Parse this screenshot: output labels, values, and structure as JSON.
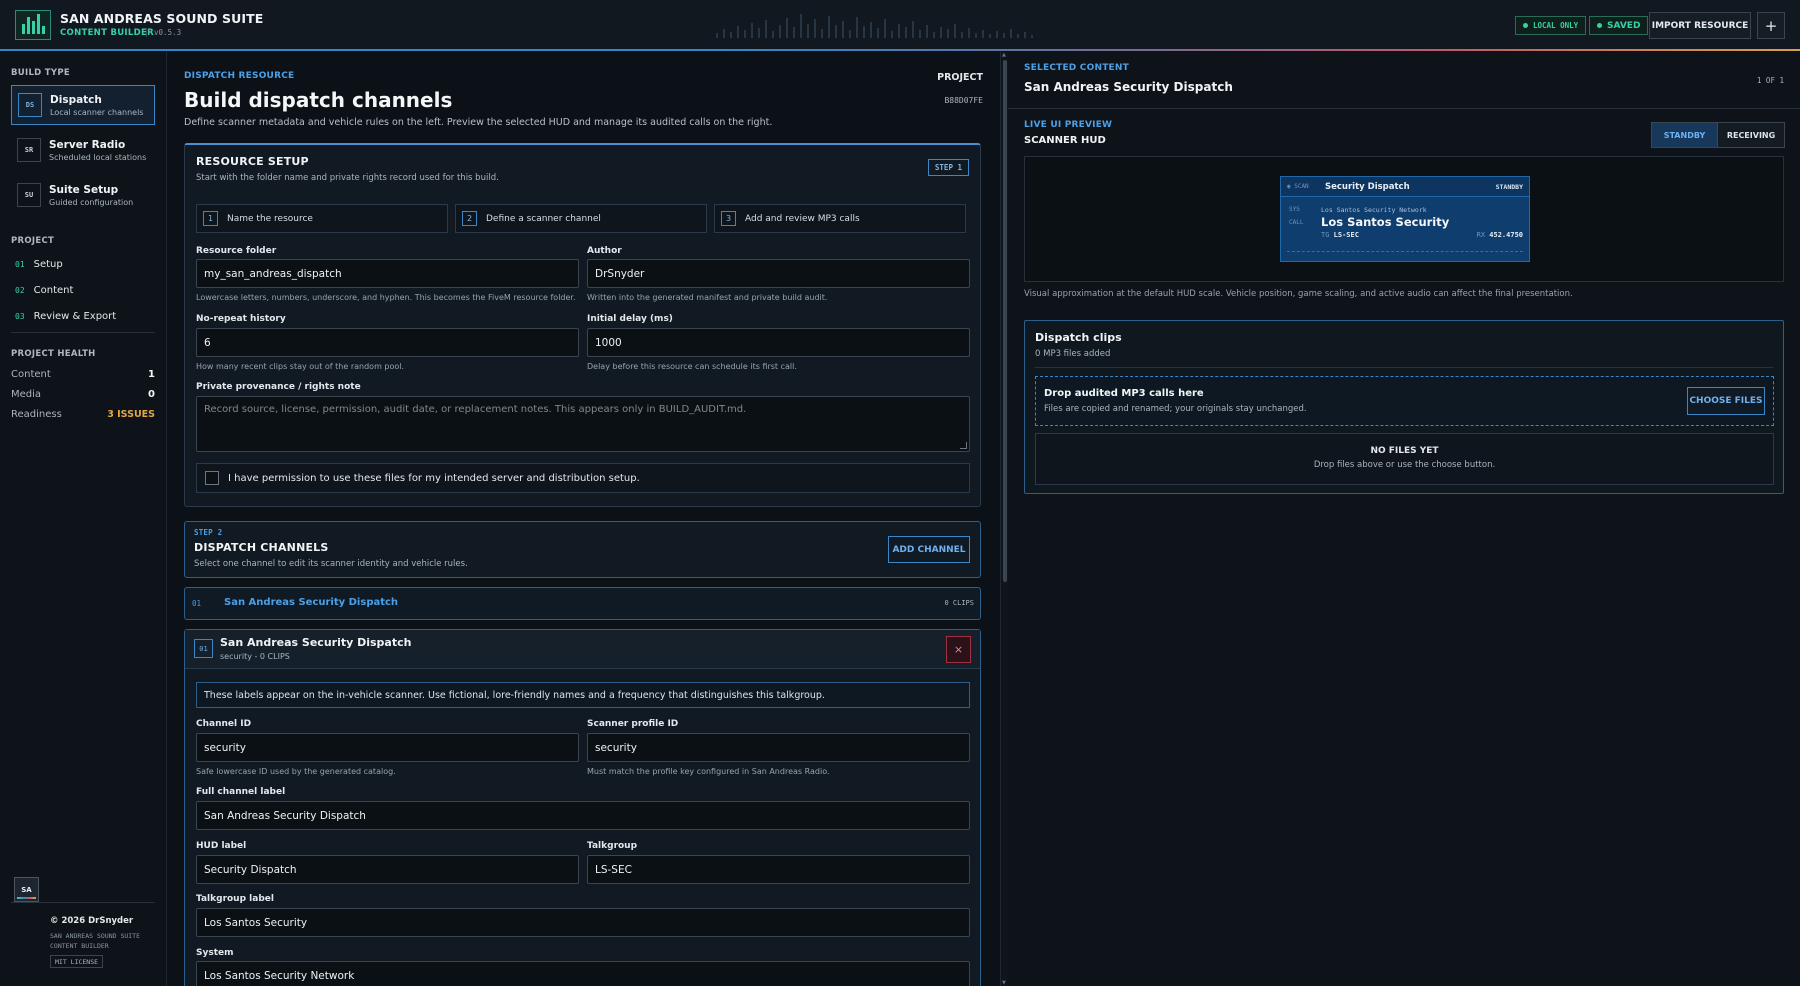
{
  "app": {
    "title": "SAN ANDREAS SOUND SUITE",
    "subtitle": "CONTENT BUILDER",
    "version": "v0.5.3"
  },
  "header": {
    "status_local": "LOCAL ONLY",
    "status_saved": "SAVED",
    "import_label": "IMPORT RESOURCE",
    "add_label": "+"
  },
  "sidebar": {
    "build_type_heading": "BUILD TYPE",
    "build_types": [
      {
        "icon": "DS",
        "name": "Dispatch",
        "desc": "Local scanner channels",
        "active": true
      },
      {
        "icon": "SR",
        "name": "Server Radio",
        "desc": "Scheduled local stations",
        "active": false
      },
      {
        "icon": "SU",
        "name": "Suite Setup",
        "desc": "Guided configuration",
        "active": false
      }
    ],
    "project_heading": "PROJECT",
    "project_items": [
      {
        "num": "01",
        "label": "Setup"
      },
      {
        "num": "02",
        "label": "Content"
      },
      {
        "num": "03",
        "label": "Review & Export"
      }
    ],
    "health_heading": "PROJECT HEALTH",
    "health": [
      {
        "label": "Content",
        "value": "1"
      },
      {
        "label": "Media",
        "value": "0"
      },
      {
        "label": "Readiness",
        "value": "3 ISSUES"
      }
    ],
    "footer": {
      "logo": "SA",
      "copyright": "© 2026 DrSnyder",
      "line1": "SAN ANDREAS SOUND SUITE",
      "line2": "CONTENT BUILDER",
      "license": "MIT LICENSE"
    }
  },
  "main": {
    "kicker": "DISPATCH RESOURCE",
    "title": "Build dispatch channels",
    "description": "Define scanner metadata and vehicle rules on the left. Preview the selected HUD and manage its audited calls on the right.",
    "project_label": "PROJECT",
    "project_id": "B88D07FE",
    "setup": {
      "heading": "RESOURCE SETUP",
      "sub": "Start with the folder name and private rights record used for this build.",
      "step_badge": "STEP 1",
      "steps": [
        {
          "num": "1",
          "label": "Name the resource"
        },
        {
          "num": "2",
          "label": "Define a scanner channel"
        },
        {
          "num": "3",
          "label": "Add and review MP3 calls"
        }
      ],
      "folder_label": "Resource folder",
      "folder_value": "my_san_andreas_dispatch",
      "folder_hint": "Lowercase letters, numbers, underscore, and hyphen. This becomes the FiveM resource folder.",
      "author_label": "Author",
      "author_value": "DrSnyder",
      "author_hint": "Written into the generated manifest and private build audit.",
      "norepeat_label": "No-repeat history",
      "norepeat_value": "6",
      "norepeat_hint": "How many recent clips stay out of the random pool.",
      "delay_label": "Initial delay (ms)",
      "delay_value": "1000",
      "delay_hint": "Delay before this resource can schedule its first call.",
      "rights_label": "Private provenance / rights note",
      "rights_placeholder": "Record source, license, permission, audit date, or replacement notes. This appears only in BUILD_AUDIT.md.",
      "permission_label": "I have permission to use these files for my intended server and distribution setup."
    },
    "channels": {
      "step_kicker": "STEP 2",
      "heading": "DISPATCH CHANNELS",
      "sub": "Select one channel to edit its scanner identity and vehicle rules.",
      "add_label": "ADD CHANNEL",
      "list": [
        {
          "num": "01",
          "name": "San Andreas Security Dispatch",
          "clips": "0 CLIPS"
        }
      ]
    },
    "editor": {
      "num": "01",
      "name": "San Andreas Security Dispatch",
      "meta": "security - 0 CLIPS",
      "delete_label": "×",
      "info": "These labels appear on the in-vehicle scanner. Use fictional, lore-friendly names and a frequency that distinguishes this talkgroup.",
      "channel_id_label": "Channel ID",
      "channel_id_value": "security",
      "channel_id_hint": "Safe lowercase ID used by the generated catalog.",
      "profile_label": "Scanner profile ID",
      "profile_value": "security",
      "profile_hint": "Must match the profile key configured in San Andreas Radio.",
      "full_label_label": "Full channel label",
      "full_label_value": "San Andreas Security Dispatch",
      "hud_label_label": "HUD label",
      "hud_label_value": "Security Dispatch",
      "talkgroup_label": "Talkgroup",
      "talkgroup_value": "LS-SEC",
      "tg_label_label": "Talkgroup label",
      "tg_label_value": "Los Santos Security",
      "system_label": "System",
      "system_value": "Los Santos Security Network"
    }
  },
  "right": {
    "kicker": "SELECTED CONTENT",
    "title": "San Andreas Security Dispatch",
    "count": "1 OF 1",
    "preview_kicker": "LIVE UI PREVIEW",
    "preview_title": "SCANNER HUD",
    "modes": [
      "STANDBY",
      "RECEIVING"
    ],
    "hud": {
      "scan": "◉ SCAN",
      "name": "Security Dispatch",
      "state": "STANDBY",
      "sys_label": "SYS",
      "sys_value": "Los Santos Security Network",
      "call_label": "CALL",
      "tg_label": "Los Santos Security",
      "tg_prefix": "TG",
      "tg_id": "LS-SEC",
      "freq_prefix": "RX",
      "freq": "452.4750"
    },
    "preview_note": "Visual approximation at the default HUD scale. Vehicle position, game scaling, and active audio can affect the final presentation.",
    "clips": {
      "heading": "Dispatch clips",
      "sub": "0 MP3 files added",
      "drop_title": "Drop audited MP3 calls here",
      "drop_sub": "Files are copied and renamed; your originals stay unchanged.",
      "choose_label": "CHOOSE FILES",
      "empty_title": "NO FILES YET",
      "empty_sub": "Drop files above or use the choose button."
    }
  }
}
